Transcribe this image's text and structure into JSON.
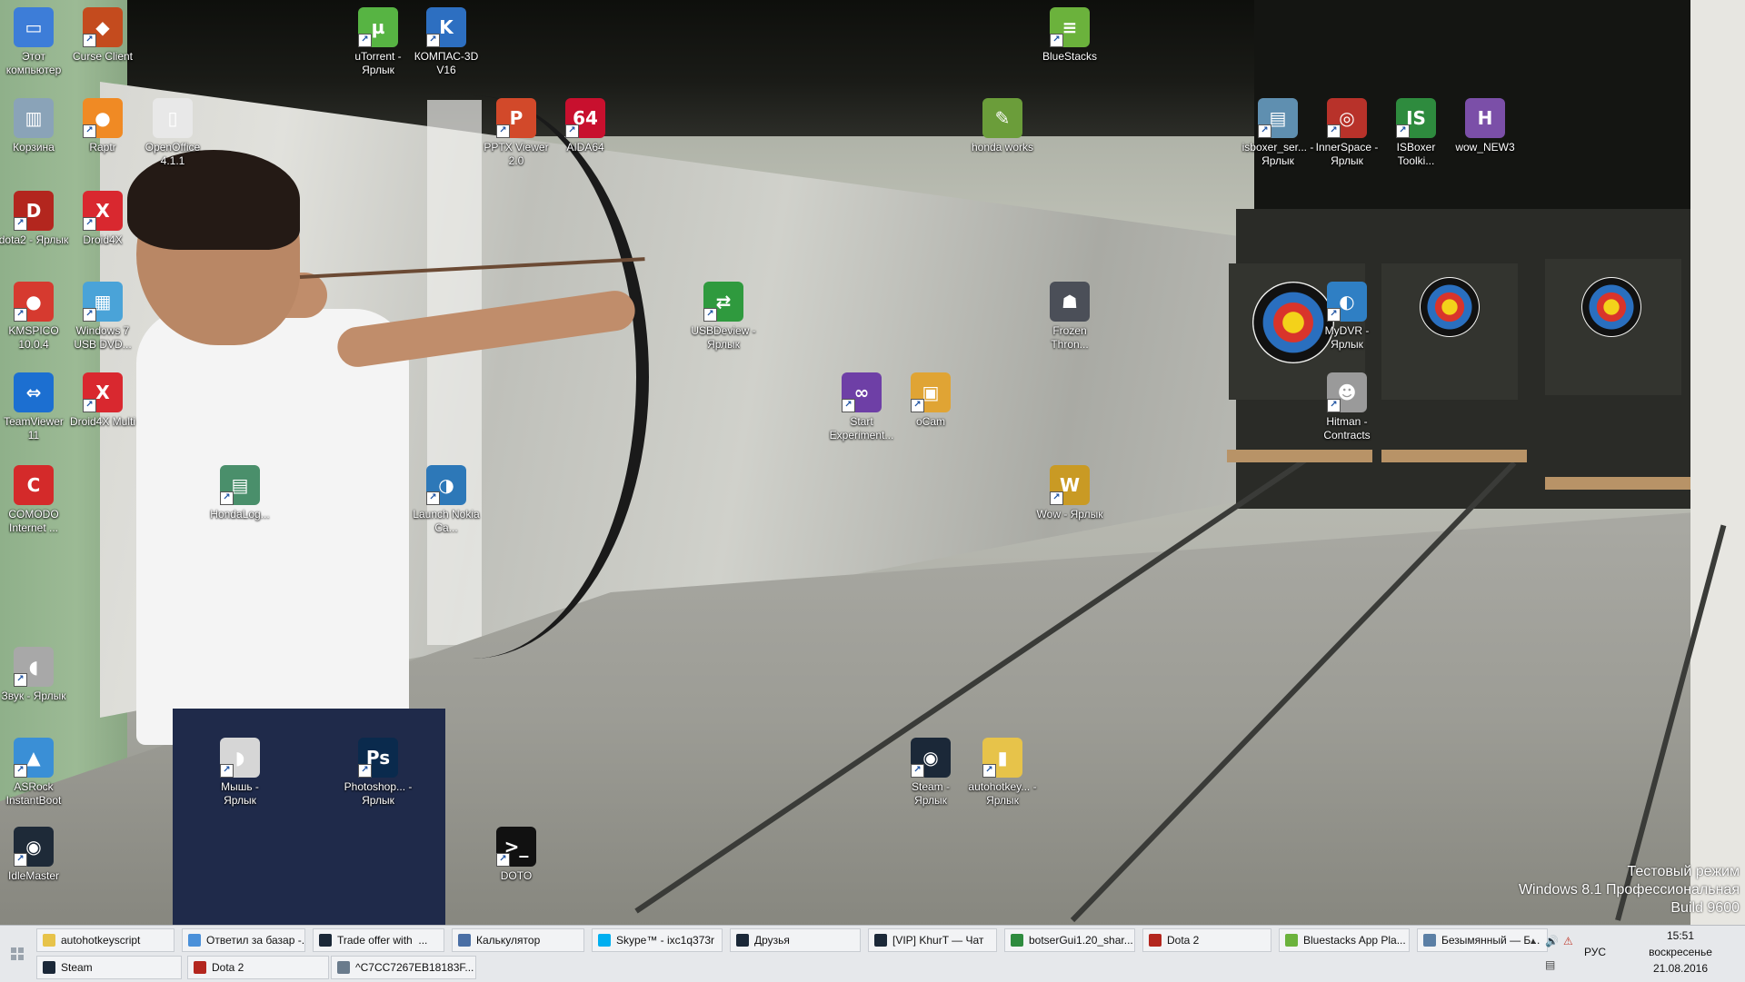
{
  "desktop": {
    "icons": [
      {
        "label": "Этот компьютер",
        "color": "#3d7dd8",
        "glyph": "▭",
        "shortcut": false
      },
      {
        "label": "Curse Client",
        "color": "#c44b1e",
        "glyph": "◆",
        "shortcut": true
      },
      {
        "label": "uTorrent - Ярлык",
        "color": "#57b443",
        "glyph": "µ",
        "shortcut": true
      },
      {
        "label": "КОМПАС-3D V16",
        "color": "#2d6fc1",
        "glyph": "K",
        "shortcut": true
      },
      {
        "label": "BlueStacks",
        "color": "#6bb23c",
        "glyph": "≡",
        "shortcut": true
      },
      {
        "label": "Корзина",
        "color": "#8aa3b8",
        "glyph": "▥",
        "shortcut": false
      },
      {
        "label": "Raptr",
        "color": "#f08a24",
        "glyph": "●",
        "shortcut": true
      },
      {
        "label": "OpenOffice 4.1.1",
        "color": "#e8e8e8",
        "glyph": "▯",
        "shortcut": false
      },
      {
        "label": "PPTX Viewer 2.0",
        "color": "#d2492a",
        "glyph": "P",
        "shortcut": true
      },
      {
        "label": "AIDA64",
        "color": "#c8102e",
        "glyph": "64",
        "shortcut": true
      },
      {
        "label": "honda works",
        "color": "#6b9d3a",
        "glyph": "✎",
        "shortcut": false
      },
      {
        "label": "isboxer_ser... - Ярлык",
        "color": "#5f8fb0",
        "glyph": "▤",
        "shortcut": true
      },
      {
        "label": "InnerSpace - Ярлык",
        "color": "#b8322a",
        "glyph": "◎",
        "shortcut": true
      },
      {
        "label": "ISBoxer Toolki...",
        "color": "#2e8b3e",
        "glyph": "IS",
        "shortcut": true
      },
      {
        "label": "wow_NEW3",
        "color": "#7b4fa8",
        "glyph": "H",
        "shortcut": false
      },
      {
        "label": "dota2 - Ярлык",
        "color": "#b3261e",
        "glyph": "D",
        "shortcut": true
      },
      {
        "label": "Droid4X",
        "color": "#d9282f",
        "glyph": "X",
        "shortcut": true
      },
      {
        "label": "KMSPICO 10.0.4",
        "color": "#d63a2f",
        "glyph": "●",
        "shortcut": true
      },
      {
        "label": "Windows 7 USB DVD...",
        "color": "#4aa3d8",
        "glyph": "▦",
        "shortcut": true
      },
      {
        "label": "USBDeview - Ярлык",
        "color": "#2f9a3e",
        "glyph": "⇄",
        "shortcut": true
      },
      {
        "label": "Frozen Thron...",
        "color": "#4b4f58",
        "glyph": "☗",
        "shortcut": false
      },
      {
        "label": "MyDVR - Ярлык",
        "color": "#2f7fc4",
        "glyph": "◐",
        "shortcut": true
      },
      {
        "label": "TeamViewer 11",
        "color": "#1c6fd1",
        "glyph": "⇔",
        "shortcut": false
      },
      {
        "label": "Droid4X Multi",
        "color": "#d9282f",
        "glyph": "X",
        "shortcut": true
      },
      {
        "label": "Start Experiment...",
        "color": "#6e3fa6",
        "glyph": "∞",
        "shortcut": true
      },
      {
        "label": "oCam",
        "color": "#e0a434",
        "glyph": "▣",
        "shortcut": true
      },
      {
        "label": "Hitman - Contracts",
        "color": "#9a9a9a",
        "glyph": "☻",
        "shortcut": true
      },
      {
        "label": "COMODO Internet ...",
        "color": "#d42a2a",
        "glyph": "C",
        "shortcut": false
      },
      {
        "label": "HondaLog...",
        "color": "#4a8f6b",
        "glyph": "▤",
        "shortcut": true
      },
      {
        "label": "Launch Nokia Ca...",
        "color": "#2d78b8",
        "glyph": "◑",
        "shortcut": true
      },
      {
        "label": "Wow - Ярлык",
        "color": "#c99a24",
        "glyph": "W",
        "shortcut": true
      },
      {
        "label": "Звук - Ярлык",
        "color": "#a8a8a8",
        "glyph": "◖",
        "shortcut": true
      },
      {
        "label": "ASRock InstantBoot",
        "color": "#3a8fd6",
        "glyph": "▲",
        "shortcut": true
      },
      {
        "label": "Мышь - Ярлык",
        "color": "#d6d6d6",
        "glyph": "◗",
        "shortcut": true
      },
      {
        "label": "Photoshop... - Ярлык",
        "color": "#0a2a4d",
        "glyph": "Ps",
        "shortcut": true
      },
      {
        "label": "Steam - Ярлык",
        "color": "#1b2838",
        "glyph": "◉",
        "shortcut": true
      },
      {
        "label": "autohotkey... - Ярлык",
        "color": "#e7c34a",
        "glyph": "▮",
        "shortcut": true
      },
      {
        "label": "IdleMaster",
        "color": "#1e2a38",
        "glyph": "◉",
        "shortcut": true
      },
      {
        "label": "DOTO",
        "color": "#111111",
        "glyph": ">_",
        "shortcut": true
      }
    ],
    "watermark": [
      "Тестовый режим",
      "Windows 8.1 Профессиональная",
      "Build 9600"
    ]
  },
  "taskbar": {
    "row1": [
      {
        "label": "autohotkeyscript",
        "color": "#e7c34a"
      },
      {
        "label": "Ответил за базар -...",
        "color": "#4a90d9"
      },
      {
        "label": "Trade offer with  ...",
        "color": "#1b2838"
      },
      {
        "label": "Калькулятор",
        "color": "#4a6fa5"
      },
      {
        "label": "Skype™ - ixc1q373r",
        "color": "#00aff0"
      },
      {
        "label": "Друзья",
        "color": "#1b2838"
      },
      {
        "label": "[VIP] KhurT — Чат",
        "color": "#1b2838"
      },
      {
        "label": "botserGui1.20_shar...",
        "color": "#2e8b3e"
      },
      {
        "label": "Dota 2",
        "color": "#b3261e"
      },
      {
        "label": "Bluestacks App Pla...",
        "color": "#6bb23c"
      },
      {
        "label": "Безымянный — Б...",
        "color": "#5b7fa5"
      }
    ],
    "row2": [
      {
        "label": "Steam",
        "color": "#1b2838"
      },
      {
        "label": "Dota 2",
        "color": "#b3261e"
      },
      {
        "label": "^C7CC7267EB18183F...",
        "color": "#6a7b8c"
      }
    ],
    "tray": {
      "chevron": "▲",
      "language": "РУС",
      "time": "15:51",
      "day": "воскресенье",
      "date": "21.08.2016"
    }
  }
}
